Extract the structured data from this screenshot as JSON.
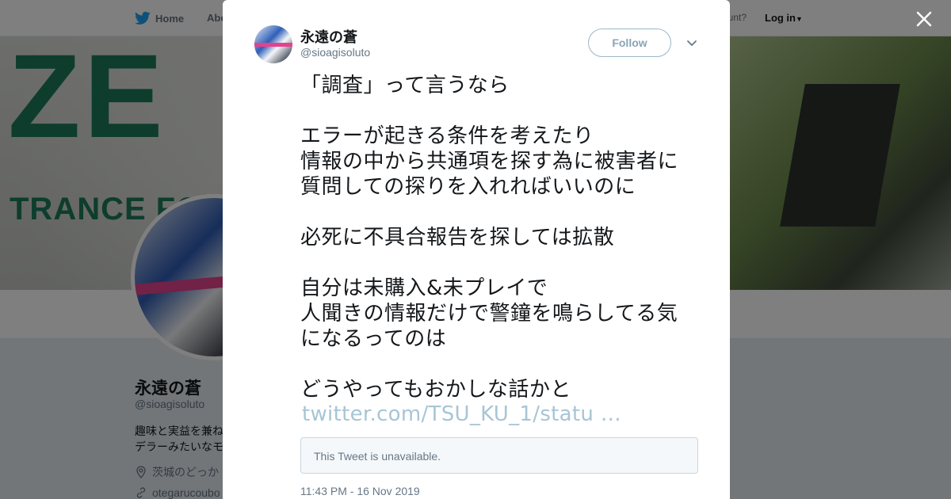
{
  "nav": {
    "home_label": "Home",
    "about_label": "Abo",
    "account_text": "ccount?",
    "login_label": "Log in"
  },
  "banner": {
    "big_text": "ZE",
    "sub_text": "TRANCE FOAN"
  },
  "profile": {
    "name": "永遠の蒼",
    "handle": "@sioagisoluto",
    "bio_line1": "趣味と実益を兼ね",
    "bio_line2": "デラーみたいなモ",
    "location": "茨城のどっか",
    "link": "otegarucoubo"
  },
  "tweet": {
    "author_name": "永遠の蒼",
    "author_handle": "@sioagisoluto",
    "follow_label": "Follow",
    "text": "「調査」って言うなら\n\nエラーが起きる条件を考えたり\n情報の中から共通項を探す為に被害者に\n質問しての探りを入れればいいのに\n\n必死に不具合報告を探しては拡散\n\n自分は未購入&未プレイで\n人聞きの情報だけで警鐘を鳴らしてる気\nになるってのは\n\nどうやってもおかしな話かと",
    "link_text": "twitter.com/TSU_KU_1/statu …",
    "quoted_unavailable": "This Tweet is unavailable.",
    "timestamp": "11:43 PM - 16 Nov 2019"
  },
  "icons": {
    "close": "close-icon",
    "chevron": "chevron-down-icon",
    "bird": "twitter-bird-icon",
    "location": "location-pin-icon",
    "link": "link-icon"
  },
  "colors": {
    "brand_blue": "#1da1f2",
    "banner_green": "#1c7a5d",
    "link_muted": "#a7c5d5",
    "text_gray": "#657786"
  }
}
